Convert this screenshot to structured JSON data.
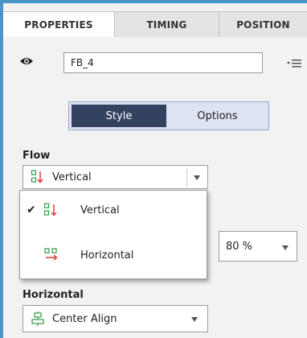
{
  "tabs": [
    "PROPERTIES",
    "TIMING",
    "POSITION"
  ],
  "name_field": {
    "value": "FB_4"
  },
  "segment": {
    "style_label": "Style",
    "options_label": "Options"
  },
  "flow": {
    "label": "Flow",
    "selected": "Vertical",
    "options": [
      {
        "label": "Vertical",
        "checked": true,
        "icon": "vertical-flow-icon"
      },
      {
        "label": "Horizontal",
        "checked": false,
        "icon": "horizontal-flow-icon"
      }
    ],
    "check_glyph": "✔"
  },
  "percent": {
    "value": "80 %"
  },
  "horizontal": {
    "label": "Horizontal",
    "selected": "Center Align",
    "icon": "center-align-icon"
  },
  "colors": {
    "accent": "#4a94c9",
    "selected_segment": "#344260",
    "icon_green": "#2e9a4a",
    "icon_red": "#e23a3a"
  }
}
